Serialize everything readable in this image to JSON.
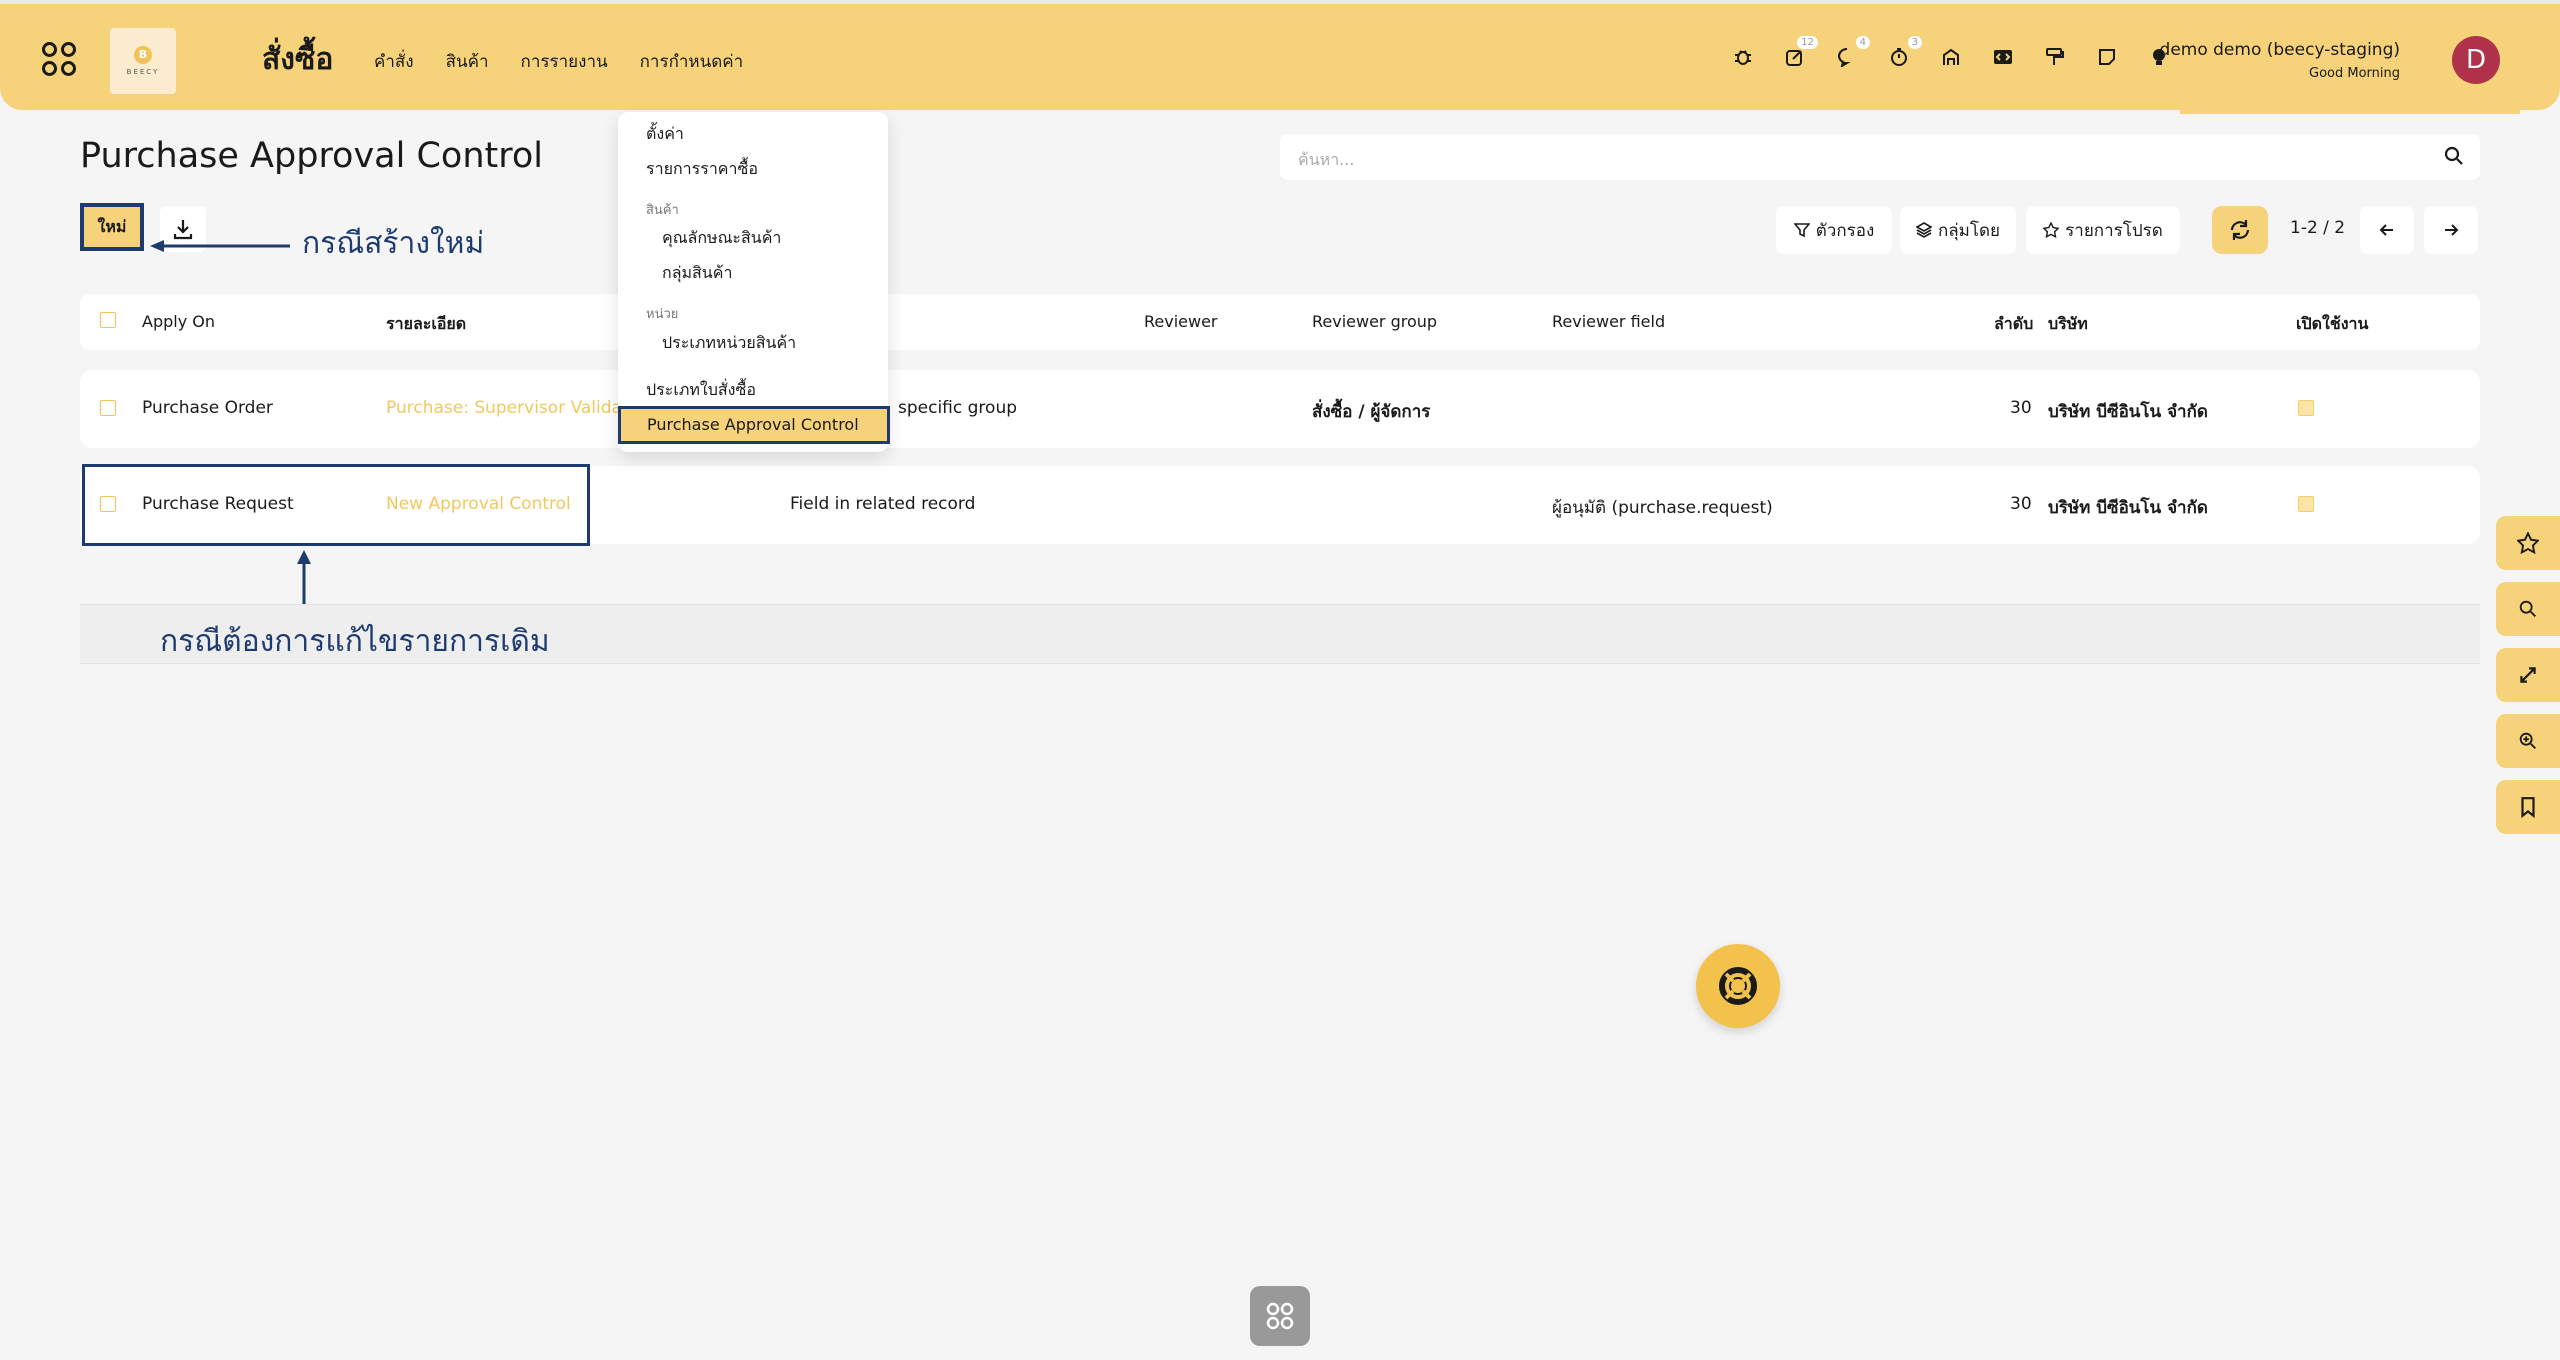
{
  "app": {
    "title": "สั่งซื้อ",
    "logo_text": "BEECY",
    "logo_letter": "B"
  },
  "top_menu": [
    "คำสั่ง",
    "สินค้า",
    "การรายงาน",
    "การกำหนดค่า"
  ],
  "systray": {
    "badges": {
      "activities": "12",
      "messages": "4",
      "timer": "3"
    }
  },
  "user": {
    "name": "demo demo (beecy-staging)",
    "greeting": "Good Morning",
    "initial": "D",
    "avatar_color": "#b0324a"
  },
  "control_panel": {
    "page_title": "Purchase Approval Control",
    "new_button": "ใหม่",
    "search_placeholder": "ค้นหา...",
    "filter_label": "ตัวกรอง",
    "groupby_label": "กลุ่มโดย",
    "favorites_label": "รายการโปรด",
    "pager": "1-2 / 2"
  },
  "annotations": {
    "new_case": "กรณีสร้างใหม่",
    "edit_case": "กรณีต้องการแก้ไขรายการเดิม"
  },
  "dropdown": {
    "settings": "ตั้งค่า",
    "pricelist": "รายการราคาซื้อ",
    "products_header": "สินค้า",
    "product_attributes": "คุณลักษณะสินค้า",
    "product_categories": "กลุ่มสินค้า",
    "uom_header": "หน่วย",
    "uom_categories": "ประเภทหน่วยสินค้า",
    "po_types": "ประเภทใบสั่งซื้อ",
    "approval_control": "Purchase Approval Control"
  },
  "table": {
    "columns": {
      "apply_on": "Apply On",
      "description": "รายละเอียด",
      "reviewer": "Reviewer",
      "reviewer_group": "Reviewer group",
      "reviewer_field": "Reviewer field",
      "sequence": "ลำดับ",
      "company": "บริษัท",
      "active": "เปิดใช้งาน"
    },
    "rows": [
      {
        "apply_on": "Purchase Order",
        "description": "Purchase: Supervisor Validat",
        "reviewer_type": "specific group",
        "reviewer": "",
        "reviewer_group": "สั่งซื้อ / ผู้จัดการ",
        "reviewer_field": "",
        "sequence": "30",
        "company": "บริษัท บีซีอินโน จำกัด",
        "active": true
      },
      {
        "apply_on": "Purchase Request",
        "description": "New Approval Control",
        "reviewer_type": "Field in related record",
        "reviewer": "",
        "reviewer_group": "",
        "reviewer_field": "ผู้อนุมัติ (purchase.request)",
        "sequence": "30",
        "company": "บริษัท บีซีอินโน จำกัด",
        "active": true
      }
    ]
  },
  "colors": {
    "brand": "#f6d37b",
    "annotation": "#1d3b6f",
    "link": "#f3c75f"
  }
}
